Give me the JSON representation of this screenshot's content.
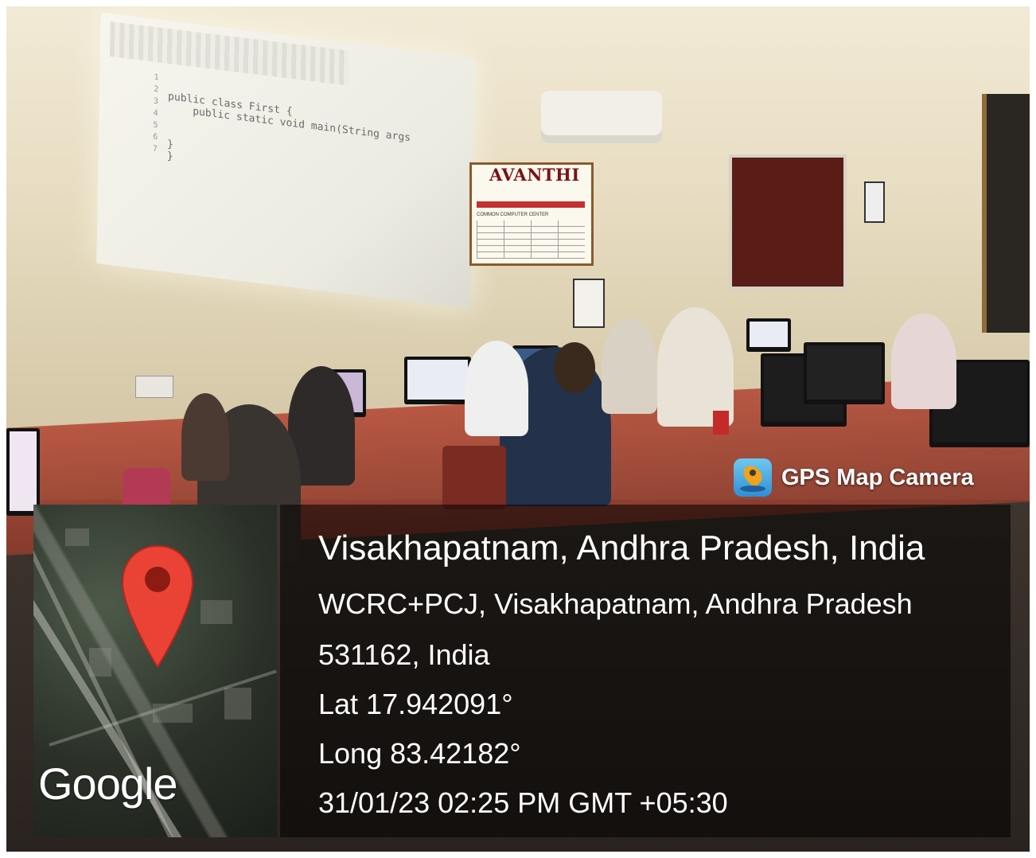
{
  "watermark": {
    "app_name": "GPS Map Camera",
    "app_icon": "gps-map-camera-icon",
    "map_brand": "Google",
    "pin_color": "#ea4335"
  },
  "location": {
    "title": "Visakhapatnam, Andhra Pradesh, India",
    "address_line1": "WCRC+PCJ, Visakhapatnam, Andhra Pradesh",
    "address_line2": "531162, India",
    "latitude": "Lat 17.942091°",
    "longitude": "Long 83.42182°",
    "datetime": "31/01/23 02:25 PM GMT +05:30"
  },
  "scene": {
    "projected_code": "public class First {\n    public static void main(String args\n\n\n}\n}",
    "projected_line_numbers": "1\n2\n3\n4\n5\n6\n7",
    "notice_board": {
      "title": "AVANTHI",
      "heading": "COMMON COMPUTER CENTER"
    }
  }
}
